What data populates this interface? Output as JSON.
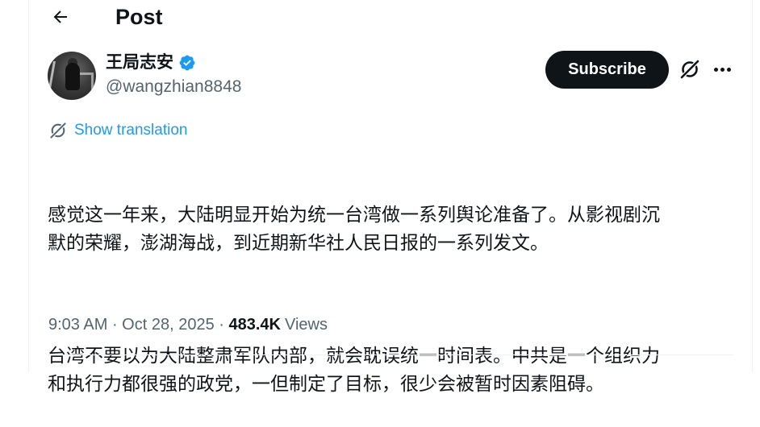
{
  "header": {
    "title": "Post"
  },
  "author": {
    "display_name": "王局志安",
    "handle": "@wangzhian8848",
    "verified": true
  },
  "actions": {
    "subscribe_label": "Subscribe"
  },
  "translation": {
    "label": "Show translation"
  },
  "tweet": {
    "paragraphs": [
      "感觉这一年来，大陆明显开始为统一台湾做一系列舆论准备了。从影视剧沉\n默的荣耀，澎湖海战，到近期新华社人民日报的一系列发文。",
      "台湾不要以为大陆整肃军队内部，就会耽误统一时间表。中共是一个组织力\n和执行力都很强的政党，一但制定了目标，很少会被暂时因素阻碍。"
    ]
  },
  "meta": {
    "time": "9:03 AM",
    "separator": " · ",
    "date": "Oct 28, 2025",
    "separator2": " · ",
    "views_count": "483.4K",
    "views_label": "Views"
  },
  "colors": {
    "text": "#0f1419",
    "secondary": "#536471",
    "accent": "#1d9bf0",
    "button_bg": "#0f1419"
  },
  "icons": [
    "back-arrow-icon",
    "verified-badge-icon",
    "grok-icon",
    "more-icon",
    "translate-icon"
  ]
}
